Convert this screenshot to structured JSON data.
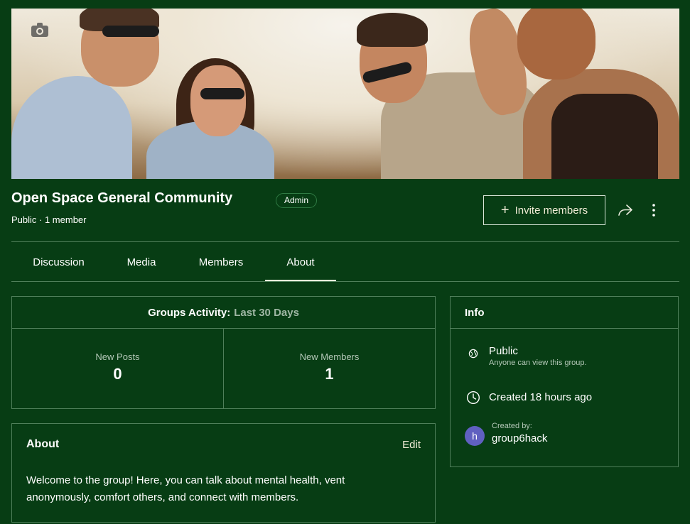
{
  "group": {
    "title": "Open Space General Community",
    "role_badge": "Admin",
    "meta": "Public · 1 member"
  },
  "header_actions": {
    "invite_label": "Invite members",
    "icons": [
      "camera-icon",
      "plus-icon",
      "share-icon",
      "more-vertical-icon"
    ]
  },
  "tabs": [
    {
      "label": "Discussion",
      "active": false
    },
    {
      "label": "Media",
      "active": false
    },
    {
      "label": "Members",
      "active": false
    },
    {
      "label": "About",
      "active": true
    }
  ],
  "activity": {
    "heading": "Groups Activity:",
    "period": "Last 30 Days",
    "stats": [
      {
        "label": "New Posts",
        "value": "0"
      },
      {
        "label": "New Members",
        "value": "1"
      }
    ]
  },
  "about": {
    "title": "About",
    "edit_label": "Edit",
    "text": "Welcome to the group! Here, you can talk about mental health, vent anonymously, comfort others, and connect with members."
  },
  "info": {
    "title": "Info",
    "privacy_label": "Public",
    "privacy_sub": "Anyone can view this group.",
    "created": "Created 18 hours ago",
    "created_by_label": "Created by:",
    "creator_initial": "h",
    "creator_name": "group6hack"
  },
  "colors": {
    "background": "#073d14",
    "border": "#4f7f5a",
    "accent_text": "#f0ecd6",
    "muted_text": "#9fb7a4",
    "avatar": "#6060c0"
  }
}
